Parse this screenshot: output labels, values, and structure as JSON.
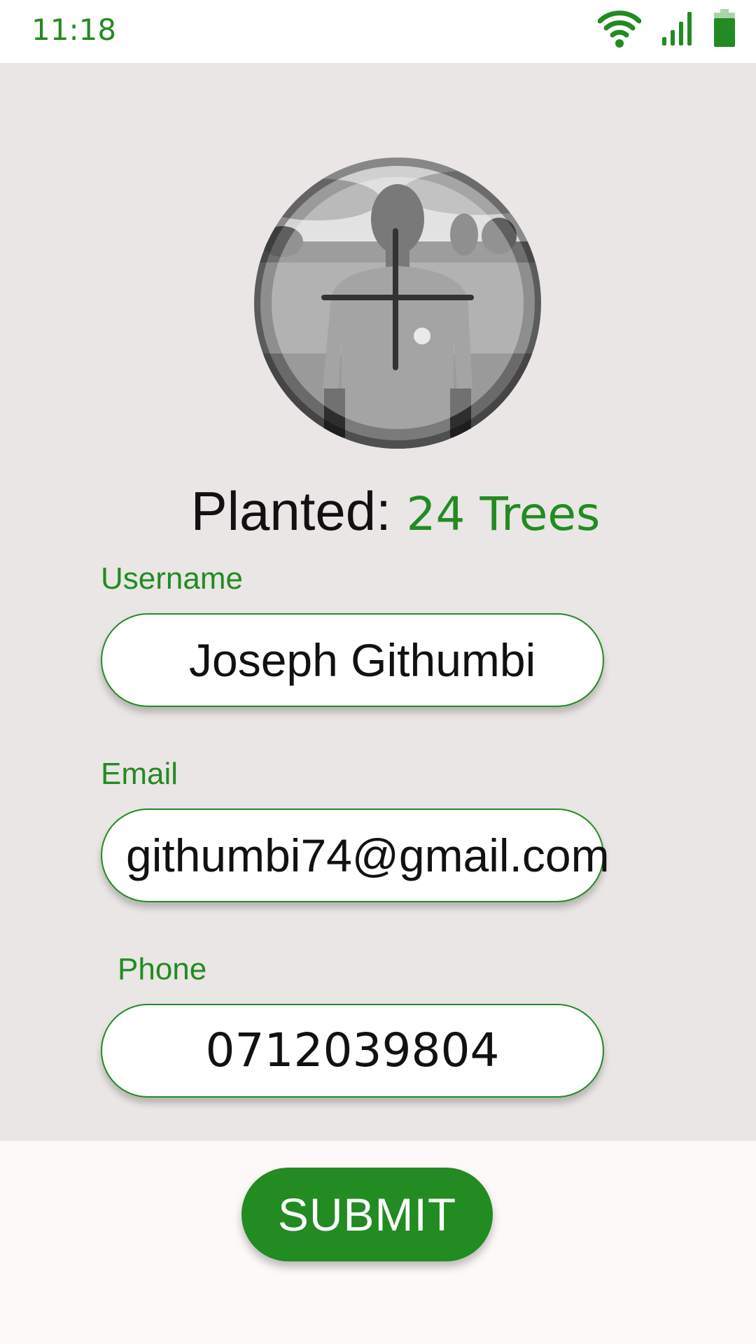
{
  "status_bar": {
    "time": "11:18",
    "icons": [
      "wifi-icon",
      "cellular-signal-icon",
      "battery-icon"
    ],
    "accent_color": "#228b22"
  },
  "profile": {
    "avatar_icon": "add-photo-crosshair-icon",
    "planted_label": "Planted:",
    "planted_count": "24 Trees"
  },
  "form": {
    "username": {
      "label": "Username",
      "value": "Joseph Githumbi"
    },
    "email": {
      "label": "Email",
      "value": "githumbi74@gmail.com"
    },
    "phone": {
      "label": "Phone",
      "value": "0712039804"
    }
  },
  "actions": {
    "submit_label": "SUBMIT"
  },
  "colors": {
    "accent": "#228b22",
    "content_background": "#eae6e5",
    "page_background": "#fcf9f8"
  }
}
